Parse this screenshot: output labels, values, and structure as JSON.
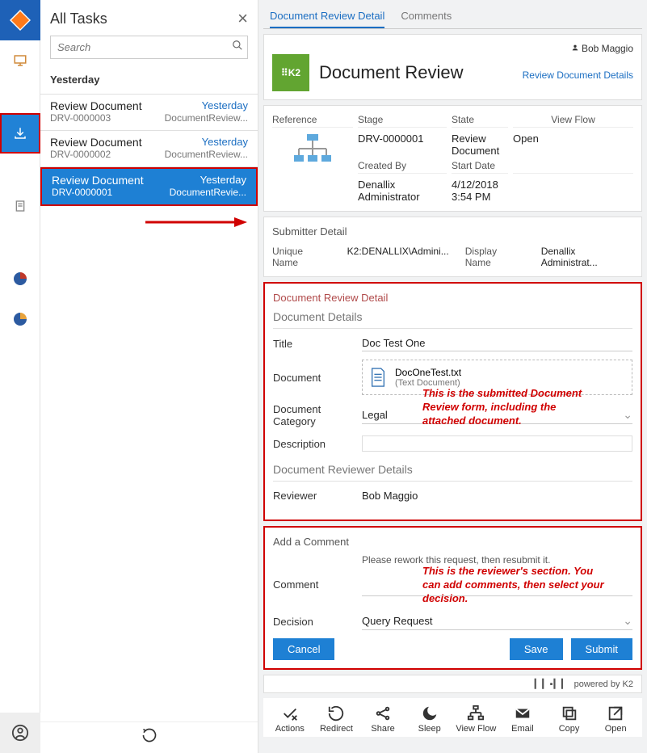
{
  "rail": {
    "logo": "K2"
  },
  "taskPane": {
    "title": "All Tasks",
    "searchPlaceholder": "Search",
    "sectionLabel": "Yesterday",
    "items": [
      {
        "title": "Review Document",
        "time": "Yesterday",
        "ref": "DRV-0000003",
        "src": "DocumentReview..."
      },
      {
        "title": "Review Document",
        "time": "Yesterday",
        "ref": "DRV-0000002",
        "src": "DocumentReview..."
      },
      {
        "title": "Review Document",
        "time": "Yesterday",
        "ref": "DRV-0000001",
        "src": "DocumentRevie..."
      }
    ]
  },
  "tabs": {
    "a": "Document Review Detail",
    "b": "Comments"
  },
  "header": {
    "user": "Bob Maggio",
    "title": "Document Review",
    "subtitle": "Review Document Details"
  },
  "meta": {
    "referenceLabel": "Reference",
    "reference": "DRV-0000001",
    "stageLabel": "Stage",
    "stage": "Review Document",
    "stateLabel": "State",
    "state": "Open",
    "viewFlowLabel": "View Flow",
    "createdByLabel": "Created By",
    "createdBy": "Denallix Administrator",
    "startDateLabel": "Start Date",
    "startDate": "4/12/2018 3:54 PM"
  },
  "submitter": {
    "section": "Submitter Detail",
    "uniqueNameLabel": "Unique Name",
    "uniqueName": "K2:DENALLIX\\Admini...",
    "displayNameLabel": "Display Name",
    "displayName": "Denallix Administrat..."
  },
  "reviewDetail": {
    "section": "Document Review Detail",
    "docDetails": "Document Details",
    "titleLabel": "Title",
    "title": "Doc Test One",
    "documentLabel": "Document",
    "fileName": "DocOneTest.txt",
    "fileType": "(Text Document)",
    "categoryLabel": "Document Category",
    "category": "Legal",
    "descriptionLabel": "Description",
    "description": "",
    "reviewerSection": "Document Reviewer Details",
    "reviewerLabel": "Reviewer",
    "reviewer": "Bob Maggio"
  },
  "annotations": {
    "a1": "This is the submitted Document Review form, including the attached document.",
    "a2": "This is the reviewer's section. You can add comments, then select your decision."
  },
  "commentBox": {
    "section": "Add a Comment",
    "existing": "Please rework this request, then resubmit it.",
    "commentLabel": "Comment",
    "decisionLabel": "Decision",
    "decision": "Query Request",
    "cancel": "Cancel",
    "save": "Save",
    "submit": "Submit"
  },
  "powered": "powered by K2",
  "toolbar": {
    "actions": "Actions",
    "redirect": "Redirect",
    "share": "Share",
    "sleep": "Sleep",
    "viewflow": "View Flow",
    "email": "Email",
    "copy": "Copy",
    "open": "Open"
  }
}
